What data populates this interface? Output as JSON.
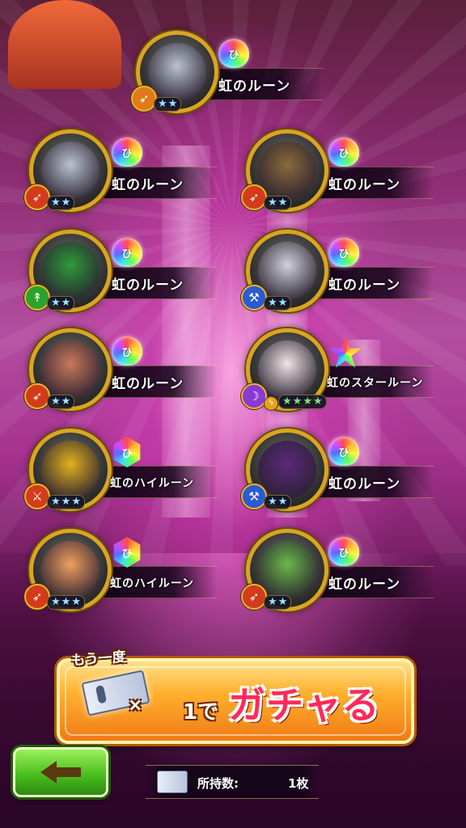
{
  "results": [
    {
      "rune_name": "虹のルーン",
      "rune_type": "drop",
      "stars": 2,
      "star_color": "blue",
      "class_icon": "bow-icon",
      "class_color": "#e07a1a",
      "portrait": "knight-helmet",
      "portrait_color": "#b9c3cf"
    },
    {
      "rune_name": "虹のルーン",
      "rune_type": "drop",
      "stars": 2,
      "star_color": "blue",
      "class_icon": "bow-icon",
      "class_color": "#d43b1a",
      "portrait": "knight-helmet",
      "portrait_color": "#b9c3cf"
    },
    {
      "rune_name": "虹のルーン",
      "rune_type": "drop",
      "stars": 2,
      "star_color": "blue",
      "class_icon": "bow-icon",
      "class_color": "#d43b1a",
      "portrait": "brown-cat",
      "portrait_color": "#8a6a3a"
    },
    {
      "rune_name": "虹のルーン",
      "rune_type": "drop",
      "stars": 2,
      "star_color": "blue",
      "class_icon": "spear-icon",
      "class_color": "#2aa32a",
      "portrait": "green-armor",
      "portrait_color": "#2e9a3a"
    },
    {
      "rune_name": "虹のルーン",
      "rune_type": "drop",
      "stars": 2,
      "star_color": "blue",
      "class_icon": "axe-icon",
      "class_color": "#2a5ad4",
      "portrait": "grey-cat",
      "portrait_color": "#cfd3da"
    },
    {
      "rune_name": "虹のルーン",
      "rune_type": "drop",
      "stars": 2,
      "star_color": "blue",
      "class_icon": "bow-icon",
      "class_color": "#d43b1a",
      "portrait": "owl-cat",
      "portrait_color": "#c87a5a"
    },
    {
      "rune_name": "虹のスタールーン",
      "rune_type": "star",
      "stars": 4,
      "star_color": "green",
      "class_icon": "staff-icon",
      "class_color": "#8a3ad4",
      "element_icon": "lightning-icon",
      "portrait": "white-hair-girl",
      "portrait_color": "#f0e6e6"
    },
    {
      "rune_name": "虹のハイルーン",
      "rune_type": "hex",
      "stars": 3,
      "star_color": "blue",
      "class_icon": "sword-icon",
      "class_color": "#d43b1a",
      "portrait": "pineapple-warrior",
      "portrait_color": "#e2b21e"
    },
    {
      "rune_name": "虹のルーン",
      "rune_type": "drop",
      "stars": 2,
      "star_color": "blue",
      "class_icon": "axe-icon",
      "class_color": "#2a5ad4",
      "portrait": "purple-robot",
      "portrait_color": "#5a2a7a"
    },
    {
      "rune_name": "虹のハイルーン",
      "rune_type": "hex",
      "stars": 3,
      "star_color": "blue",
      "class_icon": "bow-icon",
      "class_color": "#d43b1a",
      "portrait": "cat-girl",
      "portrait_color": "#f0a060"
    },
    {
      "rune_name": "虹のルーン",
      "rune_type": "drop",
      "stars": 2,
      "star_color": "blue",
      "class_icon": "bow-icon",
      "class_color": "#d43b1a",
      "portrait": "green-hair-elf",
      "portrait_color": "#6ab84a"
    }
  ],
  "gacha_button": {
    "again_label": "もう一度",
    "times": "×",
    "count": "1で",
    "action": "ガチャる"
  },
  "back_button": {
    "icon": "back-arrow-icon"
  },
  "owned": {
    "label": "所持数:",
    "value": "1枚"
  }
}
